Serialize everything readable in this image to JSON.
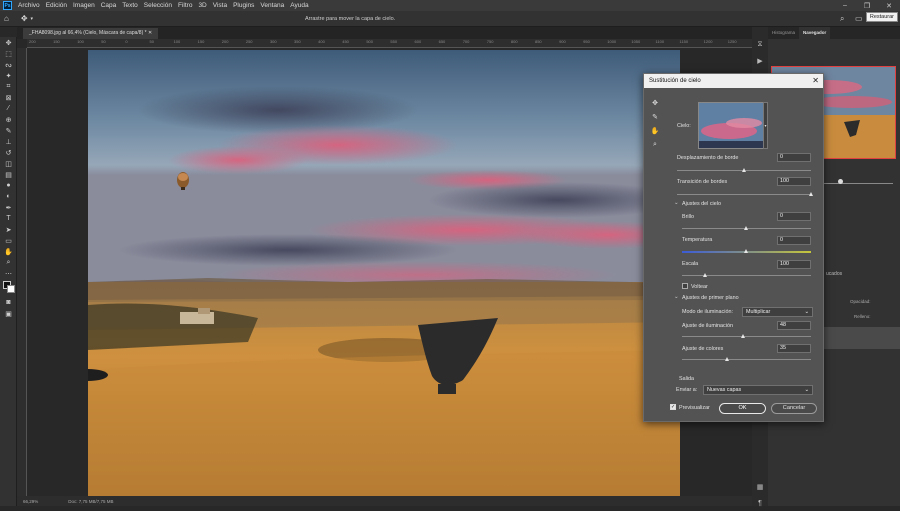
{
  "menubar": {
    "logo": "Ps",
    "items": [
      "Archivo",
      "Edición",
      "Imagen",
      "Capa",
      "Texto",
      "Selección",
      "Filtro",
      "3D",
      "Vista",
      "Plugins",
      "Ventana",
      "Ayuda"
    ],
    "tooltip": "Restaurar"
  },
  "options": {
    "hint": "Arrastre para mover la capa de cielo."
  },
  "document": {
    "tab_title": "_FHA8098.jpg al 66,4% (Cielo, Máscara de capa/8) *",
    "zoom": "66,29%",
    "doc_size": "Doc: 7,75 MB/7,75 MB"
  },
  "ruler_ticks": [
    "200",
    "150",
    "100",
    "50",
    "0",
    "50",
    "100",
    "150",
    "200",
    "250",
    "300",
    "350",
    "400",
    "450",
    "500",
    "550",
    "600",
    "650",
    "700",
    "750",
    "800",
    "850",
    "900",
    "950",
    "1000",
    "1050",
    "1100",
    "1150",
    "1200",
    "1250"
  ],
  "panels": {
    "tabs": [
      "Histograma",
      "Navegador"
    ],
    "layers_tab": "ucados",
    "opacity_label": "Opacidad:",
    "fill_label": "Relleno:"
  },
  "dialog": {
    "title": "Sustitución de cielo",
    "sky_label": "Cielo:",
    "edge_shift": {
      "label": "Desplazamiento de borde",
      "value": "0",
      "pos": 0.5
    },
    "edge_fade": {
      "label": "Transición de bordes",
      "value": "100",
      "pos": 1.0
    },
    "sky_section": "Ajustes del cielo",
    "brightness": {
      "label": "Brillo",
      "value": "0",
      "pos": 0.5
    },
    "temperature": {
      "label": "Temperatura",
      "value": "0",
      "pos": 0.5
    },
    "scale": {
      "label": "Escala",
      "value": "100",
      "pos": 0.18
    },
    "flip": {
      "label": "Voltear",
      "checked": false
    },
    "fg_section": "Ajustes de primer plano",
    "lighting_mode": {
      "label": "Modo de iluminación:",
      "value": "Multiplicar"
    },
    "lighting_adjust": {
      "label": "Ajuste de iluminación",
      "value": "48",
      "pos": 0.48
    },
    "color_adjust": {
      "label": "Ajuste de colores",
      "value": "35",
      "pos": 0.35
    },
    "output_label": "Salida",
    "output_to": {
      "label": "Enviar a:",
      "value": "Nuevas capas"
    },
    "preview": {
      "label": "Previsualizar",
      "checked": true
    },
    "ok": "OK",
    "cancel": "Cancelar"
  },
  "colors": {
    "accent": "#1473e6",
    "dialog_bg": "#535353",
    "nav_frame": "#e04040"
  }
}
